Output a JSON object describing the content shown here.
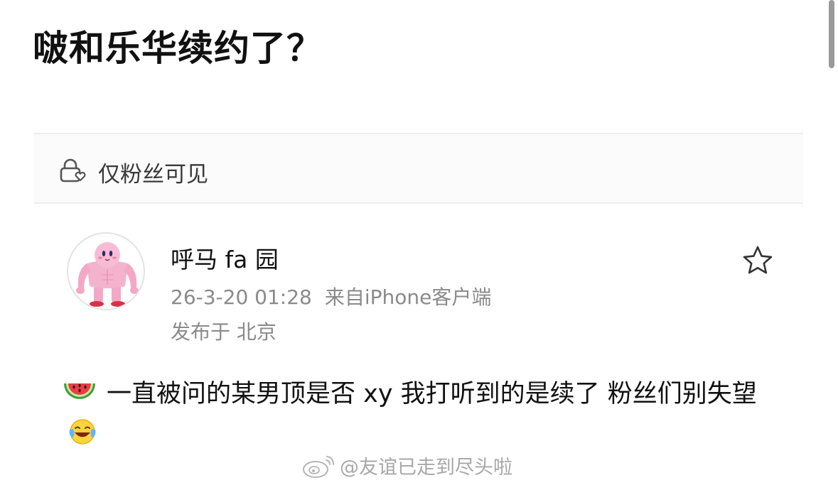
{
  "headline": "啵和乐华续约了？",
  "visibility": {
    "icon": "lock-heart-icon",
    "label": "仅粉丝可见"
  },
  "post": {
    "author": {
      "name": "呼马 fa 园",
      "avatar": "pink-muscle-character"
    },
    "datetime": "26-3-20 01:28",
    "source": "来自iPhone客户端",
    "location": "发布于 北京",
    "favorite_icon": "star-icon",
    "body": {
      "emoji_start": "watermelon-emoji",
      "text": "一直被问的某男顶是否 xy 我打听到的是续了 粉丝们别失望",
      "emoji_end": "laughing-tears-emoji"
    }
  },
  "watermark": {
    "logo": "weibo-logo",
    "text": "@友谊已走到尽头啦"
  },
  "colors": {
    "text_primary": "#111111",
    "text_secondary": "#8a8a8a",
    "background": "#ffffff",
    "bar_background": "#fbfbfb"
  }
}
